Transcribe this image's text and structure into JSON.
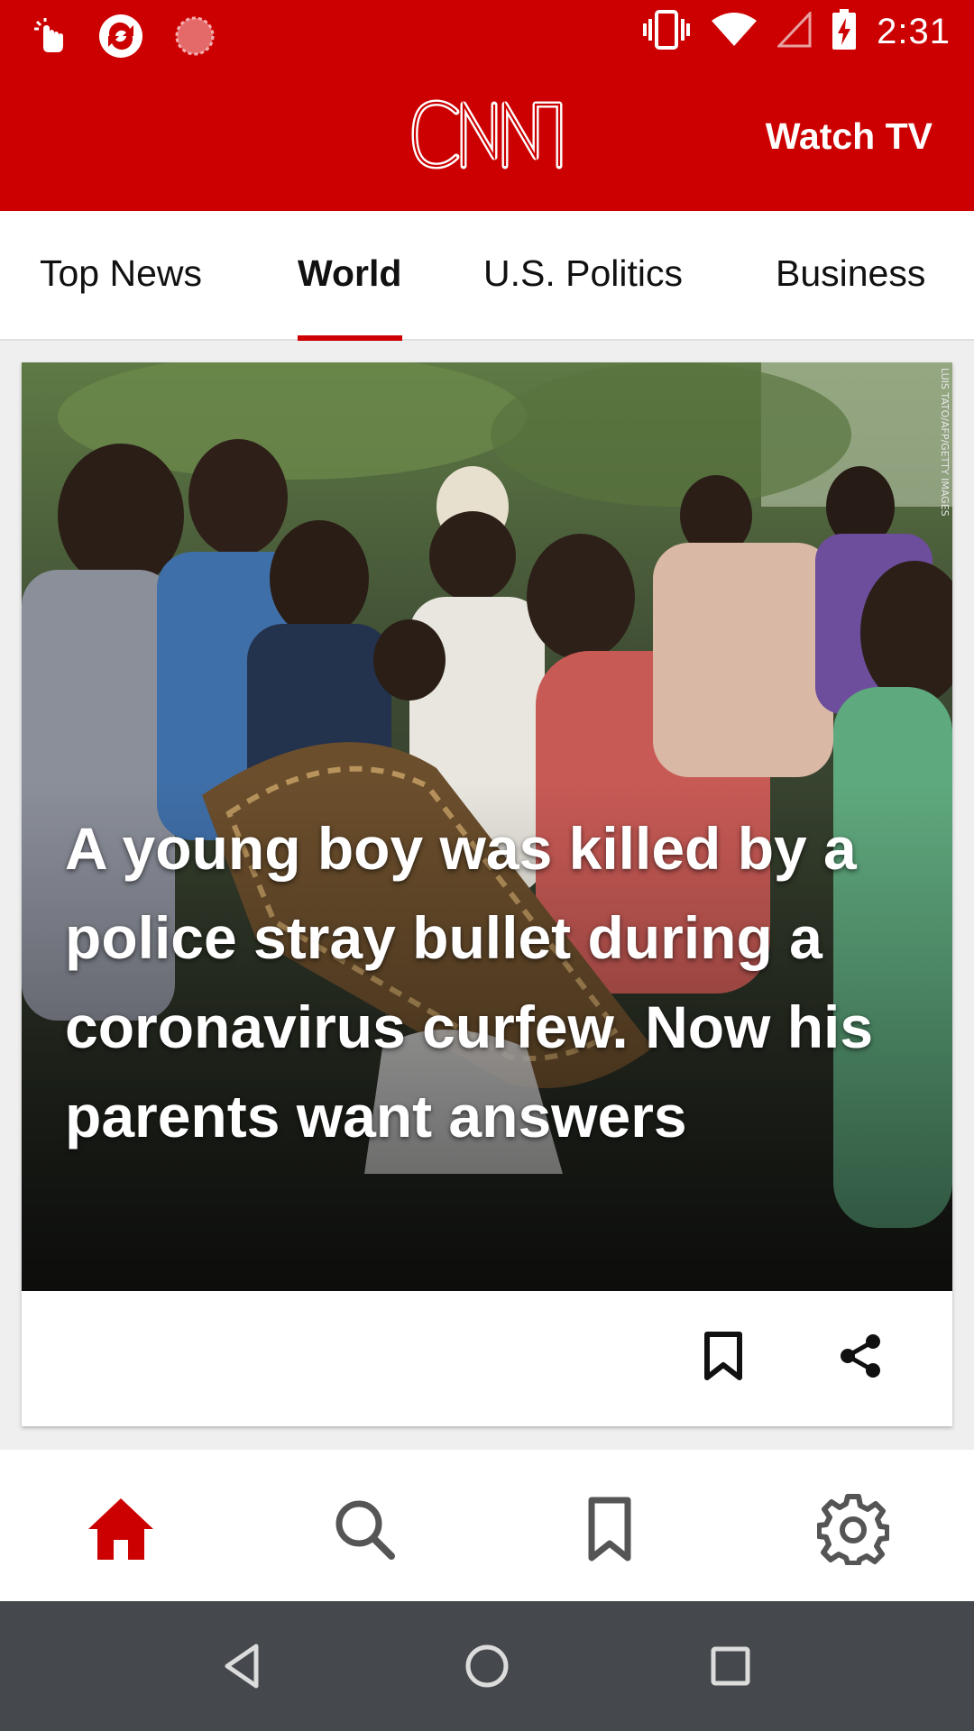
{
  "status_bar": {
    "time": "2:31",
    "icons": [
      "touch-icon",
      "sync-app-icon",
      "record-icon",
      "vibrate-icon",
      "wifi-icon",
      "cell-signal-icon",
      "battery-charging-icon"
    ]
  },
  "header": {
    "logo_text": "CNN",
    "watch_tv_label": "Watch TV",
    "brand_color": "#cc0000"
  },
  "tabs": [
    {
      "label": "Top News",
      "active": false
    },
    {
      "label": "World",
      "active": true
    },
    {
      "label": "U.S. Politics",
      "active": false
    },
    {
      "label": "Business",
      "active": false
    }
  ],
  "article": {
    "headline": "A young boy was killed by a police stray bullet during a coronavirus curfew. Now his parents want answers",
    "photo_credit": "LUIS TATO/AFP/GETTY IMAGES",
    "actions": [
      "bookmark-icon",
      "share-icon"
    ]
  },
  "bottom_nav": {
    "items": [
      "home-icon",
      "search-icon",
      "bookmark-icon",
      "settings-gear-icon"
    ],
    "active": "home-icon"
  },
  "system_nav": {
    "items": [
      "back-icon",
      "home-circle-icon",
      "recents-icon"
    ]
  }
}
